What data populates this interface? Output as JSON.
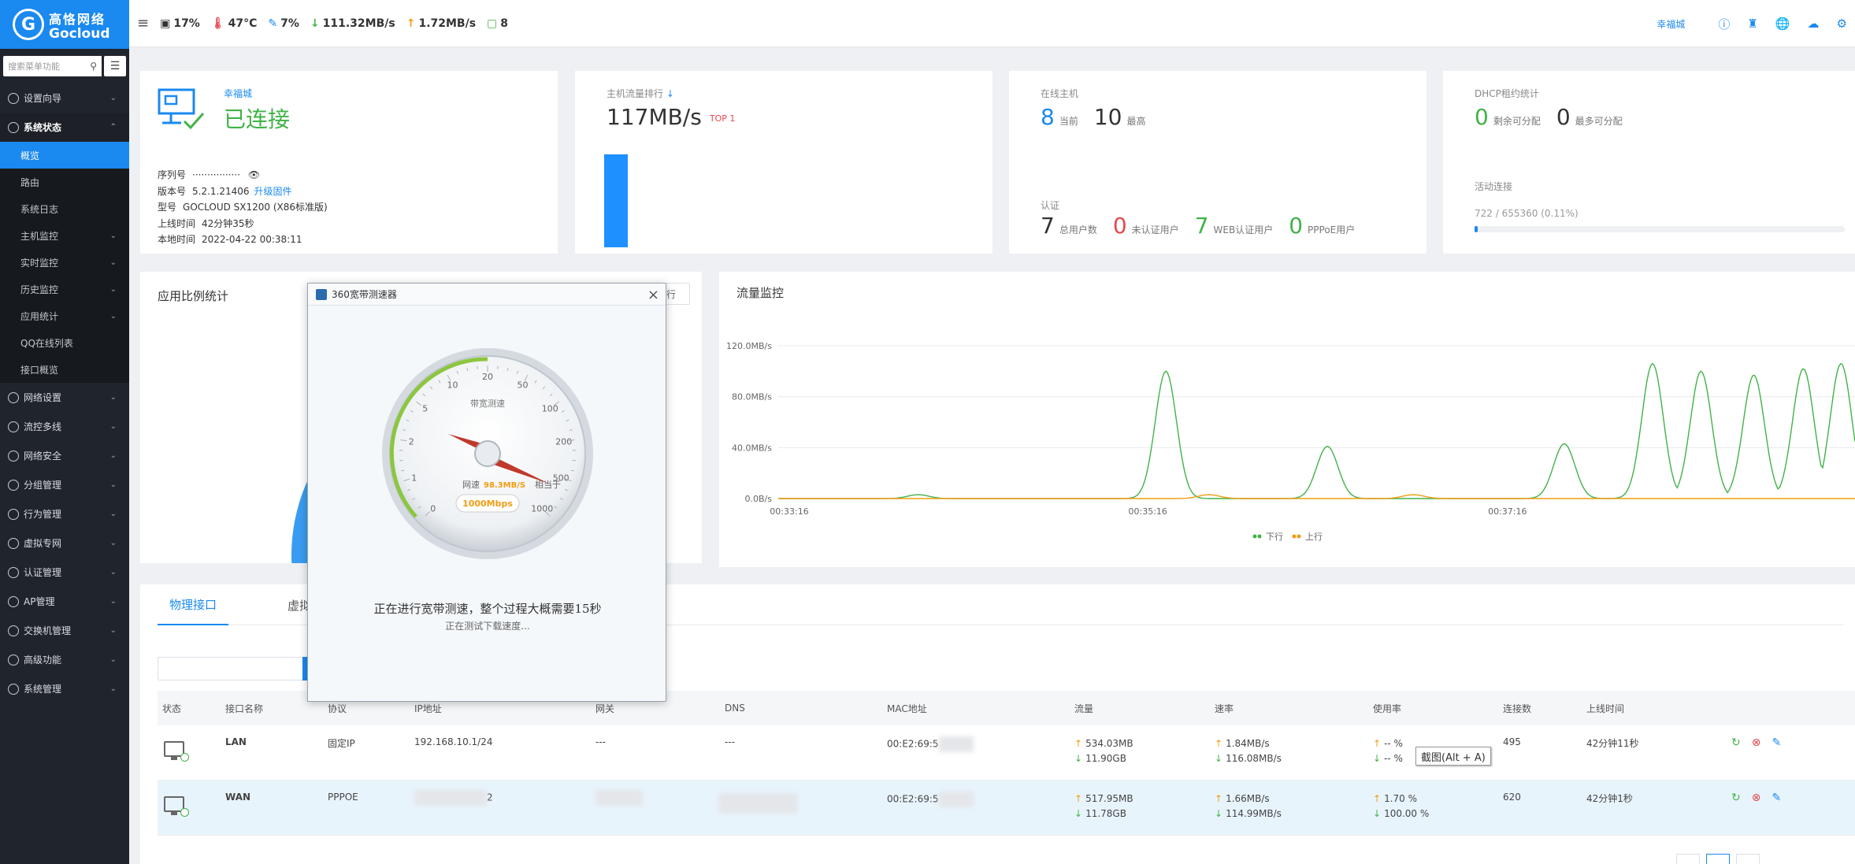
{
  "brand": {
    "cn": "高恪网络",
    "en": "Gocloud"
  },
  "sidebar": {
    "search_placeholder": "搜索菜单功能",
    "items": [
      {
        "label": "设置向导",
        "icon": "compass-icon"
      },
      {
        "label": "系统状态",
        "icon": "dashboard-icon",
        "open": true
      },
      {
        "label": "网络设置",
        "icon": "monitor-icon"
      },
      {
        "label": "流控多线",
        "icon": "flow-icon"
      },
      {
        "label": "网络安全",
        "icon": "shield-icon"
      },
      {
        "label": "分组管理",
        "icon": "group-icon"
      },
      {
        "label": "行为管理",
        "icon": "behavior-icon"
      },
      {
        "label": "虚拟专网",
        "icon": "vpn-icon"
      },
      {
        "label": "认证管理",
        "icon": "auth-icon"
      },
      {
        "label": "AP管理",
        "icon": "ap-icon"
      },
      {
        "label": "交换机管理",
        "icon": "switch-icon"
      },
      {
        "label": "高级功能",
        "icon": "advanced-icon"
      },
      {
        "label": "系统管理",
        "icon": "gear-icon"
      }
    ],
    "subitems": [
      {
        "label": "概览",
        "active": true
      },
      {
        "label": "路由"
      },
      {
        "label": "系统日志"
      },
      {
        "label": "主机监控",
        "chev": true
      },
      {
        "label": "实时监控",
        "chev": true
      },
      {
        "label": "历史监控",
        "chev": true
      },
      {
        "label": "应用统计",
        "chev": true
      },
      {
        "label": "QQ在线列表"
      },
      {
        "label": "接口概览"
      }
    ]
  },
  "topbar": {
    "cpu": "17%",
    "temp": "47°C",
    "mem": "7%",
    "down": "111.32MB/s",
    "up": "1.72MB/s",
    "hosts": "8",
    "city": "幸福城"
  },
  "card_device": {
    "city": "幸福城",
    "status": "已连接",
    "serial_label": "序列号",
    "serial_value": "················",
    "version_label": "版本号",
    "version_value": "5.2.1.21406",
    "upgrade_link": "升级固件",
    "model_label": "型号",
    "model_value": "GOCLOUD SX1200 (X86标准版)",
    "uptime_label": "上线时间",
    "uptime_value": "42分钟35秒",
    "local_label": "本地时间",
    "local_value": "2022-04-22 00:38:11"
  },
  "card_traffic": {
    "title": "主机流量排行",
    "value": "117MB/s",
    "badge": "TOP 1"
  },
  "card_hosts": {
    "title": "在线主机",
    "current": "8",
    "current_label": "当前",
    "max": "10",
    "max_label": "最高",
    "auth_title": "认证",
    "total": "7",
    "total_label": "总用户数",
    "unauth": "0",
    "unauth_label": "未认证用户",
    "web": "7",
    "web_label": "WEB认证用户",
    "pppoe": "0",
    "pppoe_label": "PPPoE用户"
  },
  "card_dhcp": {
    "title": "DHCP租约统计",
    "remain": "0",
    "remain_label": "剩余可分配",
    "max": "0",
    "max_label": "最多可分配",
    "active_title": "活动连接",
    "active_value": "722 / 655360 (0.11%)",
    "active_fraction": 0.0011
  },
  "app_stats": {
    "title": "应用比例统计",
    "button": "行"
  },
  "flow": {
    "title": "流量监控"
  },
  "chart_data": {
    "type": "line",
    "title": "流量监控",
    "y_ticks": [
      "120.0MB/s",
      "80.0MB/s",
      "40.0MB/s",
      "0.0B/s"
    ],
    "ylim": [
      0,
      120
    ],
    "x_ticks": [
      "00:33:16",
      "00:35:16",
      "00:37:16"
    ],
    "legend": "bottom-center",
    "series": [
      {
        "name": "下行",
        "color": "#41b348",
        "peaks": [
          [
            0.13,
            3
          ],
          [
            0.36,
            100
          ],
          [
            0.51,
            41
          ],
          [
            0.73,
            43
          ],
          [
            0.812,
            106
          ],
          [
            0.857,
            100
          ],
          [
            0.906,
            97
          ],
          [
            0.952,
            102
          ],
          [
            0.987,
            106
          ]
        ]
      },
      {
        "name": "上行",
        "color": "#f39c12",
        "peaks": [
          [
            0.4,
            3
          ],
          [
            0.59,
            3
          ]
        ]
      }
    ]
  },
  "tabs": [
    "物理接口",
    "虚拟接口"
  ],
  "table": {
    "headers": [
      "状态",
      "接口名称",
      "协议",
      "IP地址",
      "网关",
      "DNS",
      "MAC地址",
      "流量",
      "速率",
      "使用率",
      "连接数",
      "上线时间"
    ],
    "rows": [
      {
        "name": "LAN",
        "proto": "固定IP",
        "ip": "192.168.10.1/24",
        "gw": "---",
        "dns": "---",
        "mac": "00:E2:69:5",
        "flow_up": "534.03MB",
        "flow_dn": "11.90GB",
        "rate_up": "1.84MB/s",
        "rate_dn": "116.08MB/s",
        "use_up": "-- %",
        "use_dn": "-- %",
        "conn": "495",
        "uptime": "42分钟11秒"
      },
      {
        "name": "WAN",
        "proto": "PPPOE",
        "ip": "2",
        "gw": "",
        "dns": "",
        "mac": "00:E2:69:5",
        "flow_up": "517.95MB",
        "flow_dn": "11.78GB",
        "rate_up": "1.66MB/s",
        "rate_dn": "114.99MB/s",
        "use_up": "1.70 %",
        "use_dn": "100.00 %",
        "conn": "620",
        "uptime": "42分钟1秒"
      }
    ]
  },
  "tooltip": "截图(Alt + A)",
  "dialog": {
    "title": "360宽带测速器",
    "gauge_label": "带宽测速",
    "ticks": [
      "0",
      "1",
      "2",
      "5",
      "10",
      "20",
      "50",
      "100",
      "200",
      "500",
      "1000"
    ],
    "speed_prefix": "网速",
    "speed_value": "98.3MB/S",
    "speed_suffix": "相当于",
    "equiv": "1000Mbps",
    "message": "正在进行宽带测速，整个过程大概需要15秒",
    "sub": "正在测试下载速度..."
  }
}
